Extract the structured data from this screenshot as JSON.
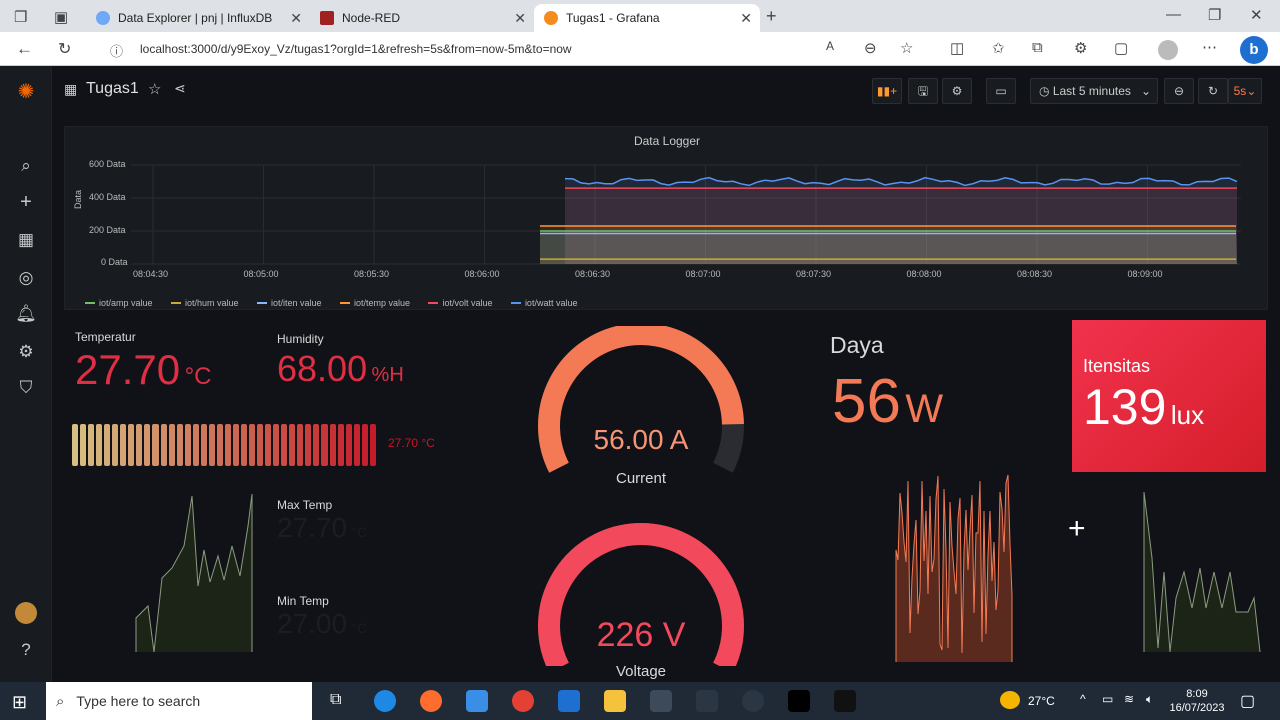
{
  "browser": {
    "tabs": [
      {
        "label": "Data Explorer | pnj | InfluxDB",
        "color": "#6fa8f7"
      },
      {
        "label": "Node-RED",
        "color": "#a12020"
      },
      {
        "label": "Tugas1 - Grafana",
        "color": "#f48b1f"
      }
    ],
    "url": "localhost:3000/d/y9Exoy_Vz/tugas1?orgId=1&refresh=5s&from=now-5m&to=now"
  },
  "dashboard": {
    "title": "Tugas1",
    "time_range": "Last 5 minutes",
    "refresh": "5s"
  },
  "data_logger": {
    "title": "Data Logger",
    "ylabel": "Data",
    "yticks": [
      "600 Data",
      "400 Data",
      "200 Data",
      "0 Data"
    ],
    "xticks": [
      "08:04:30",
      "08:05:00",
      "08:05:30",
      "08:06:00",
      "08:06:30",
      "08:07:00",
      "08:07:30",
      "08:08:00",
      "08:08:30",
      "08:09:00"
    ],
    "legend": [
      {
        "name": "iot/amp value",
        "color": "#73bf69"
      },
      {
        "name": "iot/hum value",
        "color": "#c9a93a"
      },
      {
        "name": "iot/iten value",
        "color": "#8ab8ff"
      },
      {
        "name": "iot/temp value",
        "color": "#ff9830"
      },
      {
        "name": "iot/volt value",
        "color": "#f2495c"
      },
      {
        "name": "iot/watt value",
        "color": "#5794f2"
      }
    ]
  },
  "temperatur": {
    "label": "Temperatur",
    "value": "27.70",
    "unit": "°C",
    "bar_value": "27.70 °C",
    "bar_fill": 1.0
  },
  "humidity": {
    "label": "Humidity",
    "value": "68.00",
    "unit": "%H"
  },
  "max_temp": {
    "label": "Max Temp",
    "value": "27.70",
    "unit": "°C"
  },
  "min_temp": {
    "label": "Min Temp",
    "value": "27.00",
    "unit": "°C"
  },
  "current": {
    "label": "Current",
    "value": "56.00 A",
    "fill": 0.88
  },
  "voltage": {
    "label": "Voltage",
    "value": "226 V",
    "fill": 1.0
  },
  "daya": {
    "label": "Daya",
    "value": "56",
    "unit": "W"
  },
  "itensitas": {
    "label": "Itensitas",
    "value": "139",
    "unit": "lux"
  },
  "taskbar": {
    "search_placeholder": "Type here to search",
    "weather": "27°C",
    "time": "8:09",
    "date": "16/07/2023"
  }
}
